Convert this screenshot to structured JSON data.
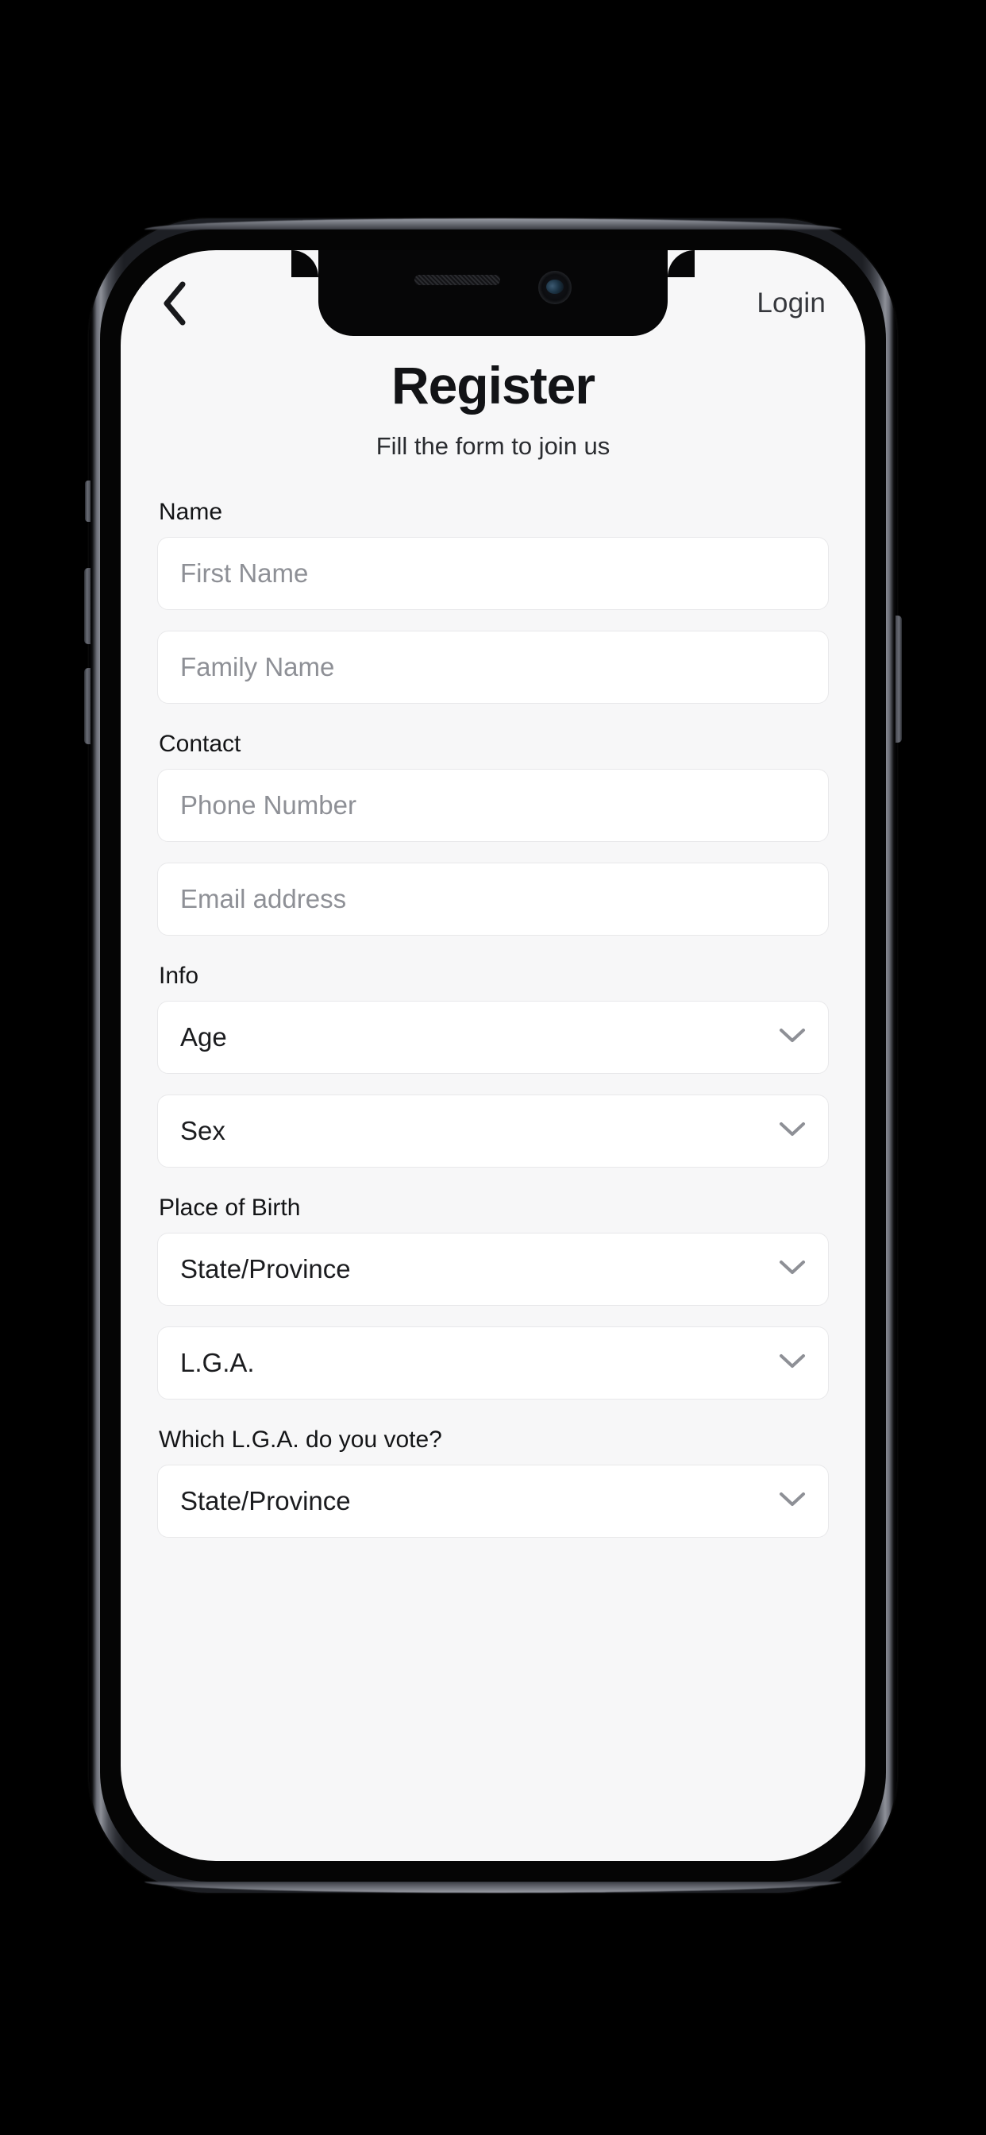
{
  "device": {
    "notch": {
      "speaker": "speaker-grille",
      "camera": "front-camera"
    },
    "buttons": [
      "mute-switch",
      "volume-up",
      "volume-down",
      "power"
    ]
  },
  "screen": {
    "topbar": {
      "back_icon": "chevron-left-icon",
      "login_label": "Login"
    },
    "header": {
      "title": "Register",
      "subtitle": "Fill the form to join us"
    },
    "form": {
      "sections": [
        {
          "label": "Name",
          "fields": [
            {
              "kind": "input",
              "placeholder": "First Name",
              "value": ""
            },
            {
              "kind": "input",
              "placeholder": "Family Name",
              "value": ""
            }
          ]
        },
        {
          "label": "Contact",
          "fields": [
            {
              "kind": "input",
              "placeholder": "Phone Number",
              "value": ""
            },
            {
              "kind": "input",
              "placeholder": "Email address",
              "value": ""
            }
          ]
        },
        {
          "label": "Info",
          "fields": [
            {
              "kind": "select",
              "value": "Age",
              "icon": "chevron-down-icon"
            },
            {
              "kind": "select",
              "value": "Sex",
              "icon": "chevron-down-icon"
            }
          ]
        },
        {
          "label": "Place of Birth",
          "fields": [
            {
              "kind": "select",
              "value": "State/Province",
              "icon": "chevron-down-icon"
            },
            {
              "kind": "select",
              "value": "L.G.A.",
              "icon": "chevron-down-icon"
            }
          ]
        },
        {
          "label": "Which L.G.A. do you vote?",
          "fields": [
            {
              "kind": "select",
              "value": "State/Province",
              "icon": "chevron-down-icon"
            }
          ]
        }
      ]
    }
  },
  "colors": {
    "page_background": "#000000",
    "screen_background": "#f7f7f8",
    "field_background": "#ffffff",
    "field_border": "#e8e8ea",
    "placeholder_text": "#8e9096",
    "primary_text": "#121316",
    "device_frame": "#2e3036"
  }
}
